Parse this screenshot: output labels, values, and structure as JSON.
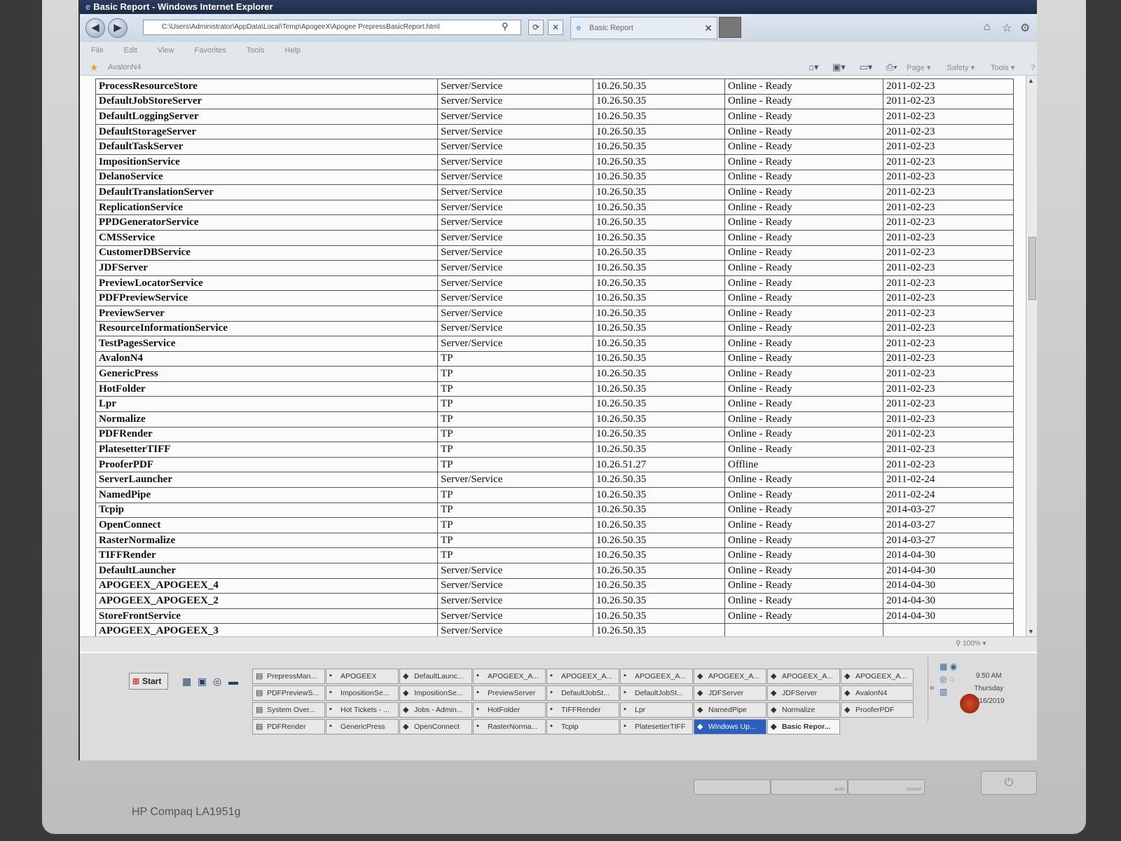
{
  "window": {
    "title": "Basic Report - Windows Internet Explorer",
    "address": "C:\\Users\\Administrator\\AppData\\Local\\Temp\\ApogeeX\\Apogee PrepressBasicReport.html",
    "tab_title": "Basic Report",
    "menu": [
      "File",
      "Edit",
      "View",
      "Favorites",
      "Tools",
      "Help"
    ],
    "favorites_item": "AvalonN4",
    "command_menu": [
      "Page ▾",
      "Safety ▾",
      "Tools ▾"
    ],
    "zoom": "100%"
  },
  "report": {
    "rows": [
      [
        "ProcessResourceStore",
        "Server/Service",
        "10.26.50.35",
        "Online - Ready",
        "2011-02-23"
      ],
      [
        "DefaultJobStoreServer",
        "Server/Service",
        "10.26.50.35",
        "Online - Ready",
        "2011-02-23"
      ],
      [
        "DefaultLoggingServer",
        "Server/Service",
        "10.26.50.35",
        "Online - Ready",
        "2011-02-23"
      ],
      [
        "DefaultStorageServer",
        "Server/Service",
        "10.26.50.35",
        "Online - Ready",
        "2011-02-23"
      ],
      [
        "DefaultTaskServer",
        "Server/Service",
        "10.26.50.35",
        "Online - Ready",
        "2011-02-23"
      ],
      [
        "ImpositionService",
        "Server/Service",
        "10.26.50.35",
        "Online - Ready",
        "2011-02-23"
      ],
      [
        "DelanoService",
        "Server/Service",
        "10.26.50.35",
        "Online - Ready",
        "2011-02-23"
      ],
      [
        "DefaultTranslationServer",
        "Server/Service",
        "10.26.50.35",
        "Online - Ready",
        "2011-02-23"
      ],
      [
        "ReplicationService",
        "Server/Service",
        "10.26.50.35",
        "Online - Ready",
        "2011-02-23"
      ],
      [
        "PPDGeneratorService",
        "Server/Service",
        "10.26.50.35",
        "Online - Ready",
        "2011-02-23"
      ],
      [
        "CMSService",
        "Server/Service",
        "10.26.50.35",
        "Online - Ready",
        "2011-02-23"
      ],
      [
        "CustomerDBService",
        "Server/Service",
        "10.26.50.35",
        "Online - Ready",
        "2011-02-23"
      ],
      [
        "JDFServer",
        "Server/Service",
        "10.26.50.35",
        "Online - Ready",
        "2011-02-23"
      ],
      [
        "PreviewLocatorService",
        "Server/Service",
        "10.26.50.35",
        "Online - Ready",
        "2011-02-23"
      ],
      [
        "PDFPreviewService",
        "Server/Service",
        "10.26.50.35",
        "Online - Ready",
        "2011-02-23"
      ],
      [
        "PreviewServer",
        "Server/Service",
        "10.26.50.35",
        "Online - Ready",
        "2011-02-23"
      ],
      [
        "ResourceInformationService",
        "Server/Service",
        "10.26.50.35",
        "Online - Ready",
        "2011-02-23"
      ],
      [
        "TestPagesService",
        "Server/Service",
        "10.26.50.35",
        "Online - Ready",
        "2011-02-23"
      ],
      [
        "AvalonN4",
        "TP",
        "10.26.50.35",
        "Online - Ready",
        "2011-02-23"
      ],
      [
        "GenericPress",
        "TP",
        "10.26.50.35",
        "Online - Ready",
        "2011-02-23"
      ],
      [
        "HotFolder",
        "TP",
        "10.26.50.35",
        "Online - Ready",
        "2011-02-23"
      ],
      [
        "Lpr",
        "TP",
        "10.26.50.35",
        "Online - Ready",
        "2011-02-23"
      ],
      [
        "Normalize",
        "TP",
        "10.26.50.35",
        "Online - Ready",
        "2011-02-23"
      ],
      [
        "PDFRender",
        "TP",
        "10.26.50.35",
        "Online - Ready",
        "2011-02-23"
      ],
      [
        "PlatesetterTIFF",
        "TP",
        "10.26.50.35",
        "Online - Ready",
        "2011-02-23"
      ],
      [
        "ProoferPDF",
        "TP",
        "10.26.51.27",
        "Offline",
        "2011-02-23"
      ],
      [
        "ServerLauncher",
        "Server/Service",
        "10.26.50.35",
        "Online - Ready",
        "2011-02-24"
      ],
      [
        "NamedPipe",
        "TP",
        "10.26.50.35",
        "Online - Ready",
        "2011-02-24"
      ],
      [
        "Tcpip",
        "TP",
        "10.26.50.35",
        "Online - Ready",
        "2014-03-27"
      ],
      [
        "OpenConnect",
        "TP",
        "10.26.50.35",
        "Online - Ready",
        "2014-03-27"
      ],
      [
        "RasterNormalize",
        "TP",
        "10.26.50.35",
        "Online - Ready",
        "2014-03-27"
      ],
      [
        "TIFFRender",
        "TP",
        "10.26.50.35",
        "Online - Ready",
        "2014-04-30"
      ],
      [
        "DefaultLauncher",
        "Server/Service",
        "10.26.50.35",
        "Online - Ready",
        "2014-04-30"
      ],
      [
        "APOGEEX_APOGEEX_4",
        "Server/Service",
        "10.26.50.35",
        "Online - Ready",
        "2014-04-30"
      ],
      [
        "APOGEEX_APOGEEX_2",
        "Server/Service",
        "10.26.50.35",
        "Online - Ready",
        "2014-04-30"
      ],
      [
        "StoreFrontService",
        "Server/Service",
        "10.26.50.35",
        "Online - Ready",
        "2014-04-30"
      ],
      [
        "APOGEEX_APOGEEX_3",
        "Server/Service",
        "10.26.50.35",
        "",
        ""
      ]
    ]
  },
  "taskbar": {
    "start_label": "Start",
    "buttons": [
      [
        "PrepressMan...",
        "APOGEEX",
        "DefaultLaunc...",
        "APOGEEX_A...",
        "APOGEEX_A...",
        "APOGEEX_A...",
        "APOGEEX_A...",
        "APOGEEX_A...",
        "APOGEEX_A..."
      ],
      [
        "PDFPreviewS...",
        "ImpositionSe...",
        "ImpositionSe...",
        "PreviewServer",
        "DefaultJobSt...",
        "DefaultJobSt...",
        "JDFServer",
        "JDFServer",
        "AvalonN4"
      ],
      [
        "System Over...",
        "Hot Tickets - ...",
        "Jobs - Admin...",
        "HotFolder",
        "TIFFRender",
        "Lpr",
        "NamedPipe",
        "Normalize",
        "ProoferPDF"
      ],
      [
        "PDFRender",
        "GenericPress",
        "OpenConnect",
        "RasterNorma...",
        "Tcpip",
        "PlatesetterTIFF",
        "Windows Up...",
        "Basic Repor..."
      ]
    ],
    "clock_time": "9:50 AM",
    "clock_day": "Thursday",
    "clock_date": "5/16/2019"
  },
  "monitor": {
    "brand": "HP Compaq LA1951g",
    "button_labels": [
      "auto",
      "source"
    ]
  }
}
